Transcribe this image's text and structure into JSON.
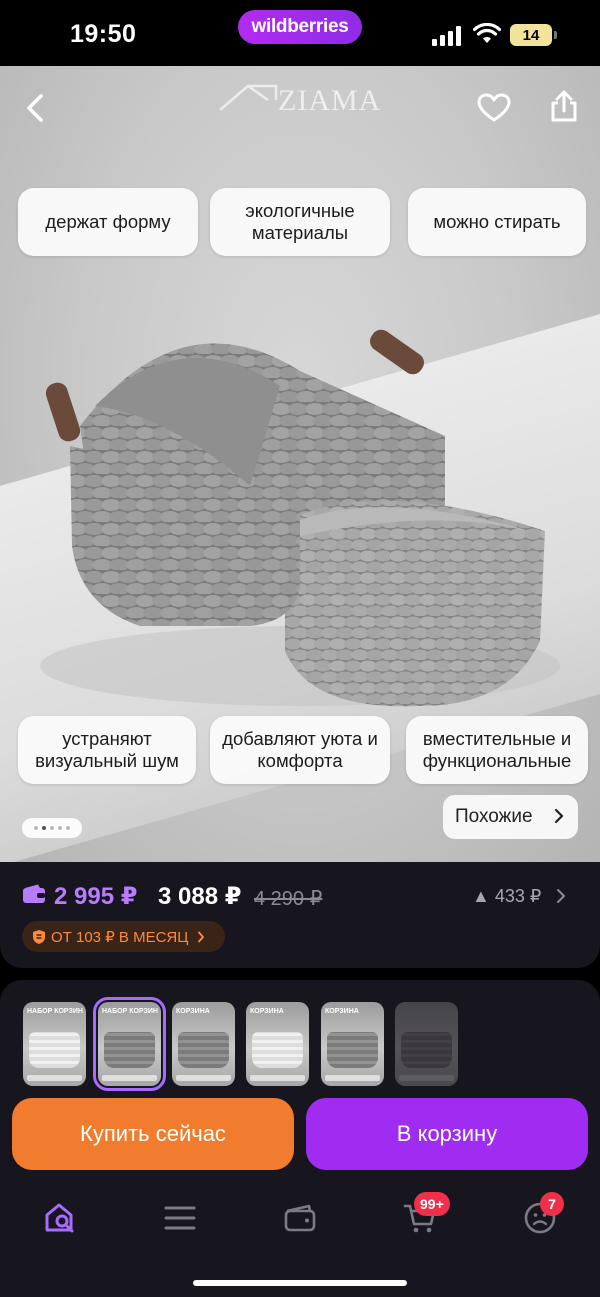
{
  "status_bar": {
    "time": "19:50",
    "app_pill": "wildberries",
    "battery": "14"
  },
  "hero": {
    "brand": "ZIAMA",
    "features_top": [
      "держат форму",
      "экологичные материалы",
      "можно стирать"
    ],
    "features_bottom": [
      "устраняют визуальный шум",
      "добавляют уюта и комфорта",
      "вместительные и функциональные"
    ],
    "gallery_dots": {
      "count": 5,
      "active_index": 1
    },
    "similar_label": "Похожие"
  },
  "price": {
    "wallet_price": "2 995 ₽",
    "price": "3 088 ₽",
    "old_price": "4 290 ₽",
    "delta": "▲ 433 ₽",
    "installment": "ОТ 103 ₽ В МЕСЯЦ"
  },
  "variants": [
    {
      "label": "НАБОР КОРЗИН",
      "selected": false,
      "style": "light"
    },
    {
      "label": "НАБОР КОРЗИН",
      "selected": true,
      "style": "dark"
    },
    {
      "label": "КОРЗИНА",
      "selected": false,
      "style": "dark"
    },
    {
      "label": "КОРЗИНА",
      "selected": false,
      "style": "light"
    },
    {
      "label": "КОРЗИНА",
      "selected": false,
      "style": "dark"
    },
    {
      "label": "",
      "selected": false,
      "style": "dim"
    }
  ],
  "actions": {
    "buy_now": "Купить сейчас",
    "to_cart": "В корзину"
  },
  "tabbar": {
    "cart_badge": "99+",
    "profile_badge": "7"
  },
  "colors": {
    "accent_purple": "#a02cf2",
    "buy_orange": "#f27c2d",
    "wallet_price": "#b77cff",
    "badge_red": "#f0304a"
  },
  "icons": {
    "back": "chevron-left-icon",
    "favorite": "heart-icon",
    "share": "share-icon",
    "home": "home-search-icon",
    "catalog": "menu-icon",
    "wallet": "wallet-icon",
    "cart": "cart-icon",
    "profile": "profile-icon"
  }
}
